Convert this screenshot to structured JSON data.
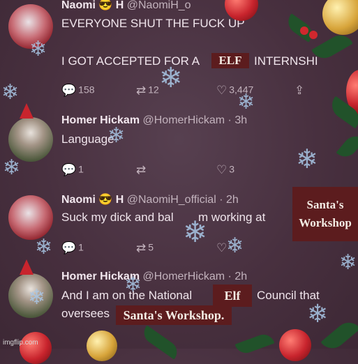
{
  "tweets": [
    {
      "name": "Naomi",
      "emoji": "😎",
      "initial": "H",
      "handle": "@NaomiH_o",
      "lines": [
        "EVERYONE SHUT THE FUCK UP",
        "I GOT ACCEPTED FOR A",
        "INTERNSHI"
      ],
      "replies": "158",
      "retweets": "12",
      "likes": "3,447"
    },
    {
      "name": "Homer Hickam",
      "handle": "@HomerHickam",
      "time": "· 3h",
      "lines": [
        "Language"
      ],
      "replies": "1",
      "retweets": "",
      "likes": "3"
    },
    {
      "name": "Naomi",
      "emoji": "😎",
      "initial": "H",
      "handle": "@NaomiH_official",
      "time": "· 2h",
      "lines": [
        "Suck my dick and bal",
        "m working at"
      ],
      "replies": "1",
      "retweets": "5",
      "likes": ""
    },
    {
      "name": "Homer Hickam",
      "handle": "@HomerHickam",
      "time": "· 2h",
      "lines": [
        "And I am on the National",
        "Council that",
        "oversees"
      ],
      "replies": "",
      "retweets": "",
      "likes": ""
    }
  ],
  "overlays": {
    "elf_1": "ELF",
    "santas_workshop_1_line1": "Santa's",
    "santas_workshop_1_line2": "Workshop",
    "elf_2": "Elf",
    "santas_workshop_2": "Santa's Workshop."
  },
  "icons": {
    "reply": "💬",
    "retweet": "⇄",
    "like": "♡",
    "share": "⇪",
    "snowflake": "❄"
  },
  "watermark": "imgflip.com",
  "colors": {
    "background": "#48303f",
    "label_box": "#5c1c1e",
    "snowflake": "#a9c7e6",
    "ornament_red": "#c8242d",
    "ornament_gold": "#d7a43a",
    "holly_green": "#21522a"
  }
}
